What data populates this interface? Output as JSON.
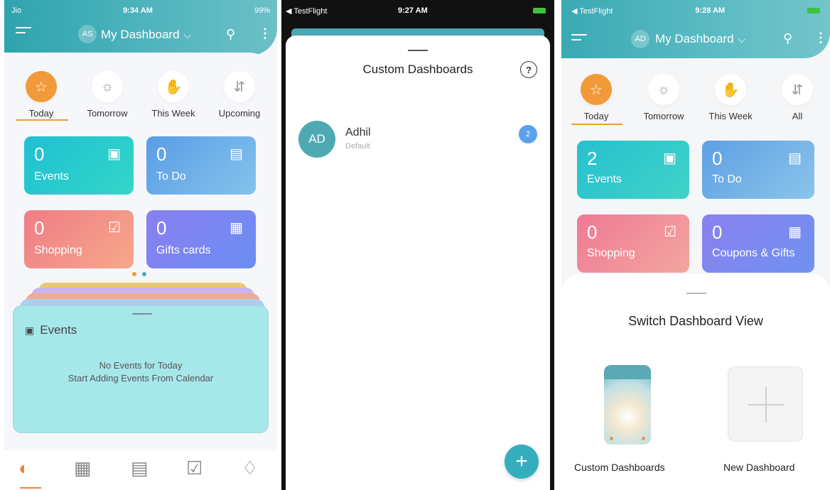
{
  "screen1": {
    "status": {
      "carrier": "Jio",
      "time": "9:34 AM",
      "battery": "99%"
    },
    "header": {
      "avatar": "AS",
      "title": "My Dashboard"
    },
    "tabs": [
      {
        "label": "Today",
        "icon": "star-icon"
      },
      {
        "label": "Tomorrow",
        "icon": "sun-icon"
      },
      {
        "label": "This Week",
        "icon": "megaphone-icon"
      },
      {
        "label": "Upcoming",
        "icon": "sort-icon"
      }
    ],
    "tiles": [
      {
        "count": "0",
        "label": "Events",
        "icon": "calendar-star-icon"
      },
      {
        "count": "0",
        "label": "To Do",
        "icon": "checklist-icon"
      },
      {
        "count": "0",
        "label": "Shopping",
        "icon": "shopping-bag-icon"
      },
      {
        "count": "0",
        "label": "Gifts cards",
        "icon": "gift-icon"
      }
    ],
    "events_panel": {
      "title": "Events",
      "line1": "No Events for Today",
      "line2": "Start Adding Events From Calendar"
    }
  },
  "screen2": {
    "status": {
      "back_app": "TestFlight",
      "time": "9:27 AM"
    },
    "sheet_title": "Custom Dashboards",
    "help": "?",
    "dashboard": {
      "avatar": "AD",
      "name": "Adhil",
      "subtitle": "Default",
      "badge": "2"
    },
    "fab": "+"
  },
  "screen3": {
    "status": {
      "back_app": "TestFlight",
      "time": "9:28 AM"
    },
    "header": {
      "avatar": "AD",
      "title": "My Dashboard"
    },
    "tabs": [
      {
        "label": "Today"
      },
      {
        "label": "Tomorrow"
      },
      {
        "label": "This Week"
      },
      {
        "label": "All"
      }
    ],
    "tiles": [
      {
        "count": "2",
        "label": "Events"
      },
      {
        "count": "0",
        "label": "To Do"
      },
      {
        "count": "0",
        "label": "Shopping"
      },
      {
        "count": "0",
        "label": "Coupons & Gifts"
      }
    ],
    "sheet_title": "Switch Dashboard View",
    "options": [
      {
        "label": "Custom Dashboards"
      },
      {
        "label": "New Dashboard"
      }
    ]
  }
}
